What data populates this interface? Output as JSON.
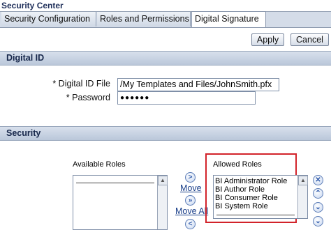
{
  "window": {
    "title": "Security Center"
  },
  "tabs": [
    {
      "label": "Security Configuration",
      "active": false
    },
    {
      "label": "Roles and Permissions",
      "active": false
    },
    {
      "label": "Digital Signature",
      "active": true
    }
  ],
  "toolbar": {
    "apply_label": "Apply",
    "cancel_label": "Cancel"
  },
  "digital_id": {
    "section_title": "Digital ID",
    "file_label": "* Digital ID File",
    "file_value": "/My Templates and Files/JohnSmith.pfx",
    "password_label": "* Password",
    "password_value": "●●●●●●"
  },
  "security": {
    "section_title": "Security",
    "available_label": "Available Roles",
    "allowed_label": "Allowed Roles",
    "move_label": "Move",
    "move_all_label": "Move All",
    "available_roles": [],
    "allowed_roles": [
      "BI Administrator Role",
      "BI Author Role",
      "BI Consumer Role",
      "BI System Role"
    ]
  },
  "colors": {
    "highlight": "#d2232a",
    "section_bg": "#c9d3e2"
  },
  "icons": {
    "move": "chevron-right-icon",
    "move_all": "double-chevron-right-icon",
    "remove": "chevron-left-icon",
    "reorder_top": "top-icon",
    "reorder_up": "up-icon",
    "reorder_down": "down-icon",
    "reorder_bottom": "bottom-icon"
  }
}
